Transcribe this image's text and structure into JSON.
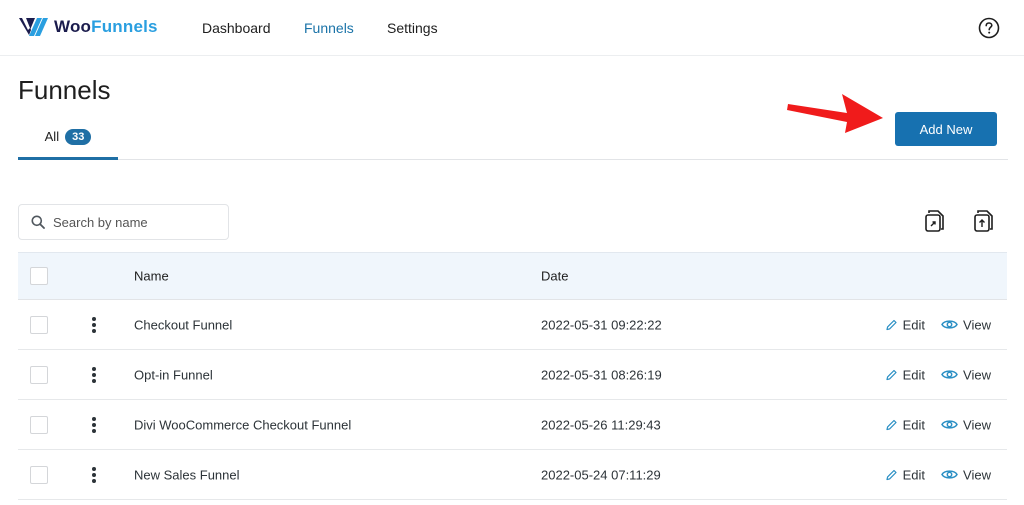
{
  "brand": {
    "part1": "Woo",
    "part2": "Funnels"
  },
  "nav": [
    {
      "label": "Dashboard",
      "active": false
    },
    {
      "label": "Funnels",
      "active": true
    },
    {
      "label": "Settings",
      "active": false
    }
  ],
  "help_icon": "help-circle-icon",
  "page": {
    "title": "Funnels"
  },
  "tabs": [
    {
      "label": "All",
      "count": "33"
    }
  ],
  "add_new_label": "Add New",
  "search": {
    "placeholder": "Search by name",
    "value": ""
  },
  "toolbar_icons": [
    "export-icon",
    "import-icon"
  ],
  "table": {
    "columns": {
      "name": "Name",
      "date": "Date"
    },
    "rows": [
      {
        "name": "Checkout Funnel",
        "date": "2022-05-31 09:22:22"
      },
      {
        "name": "Opt-in Funnel",
        "date": "2022-05-31 08:26:19"
      },
      {
        "name": "Divi WooCommerce Checkout Funnel",
        "date": "2022-05-26 11:29:43"
      },
      {
        "name": "New Sales Funnel",
        "date": "2022-05-24 07:11:29"
      }
    ],
    "actions": {
      "edit": "Edit",
      "view": "View"
    }
  },
  "colors": {
    "accent": "#1771b0",
    "nav_active": "#1a73a8",
    "logo_dark": "#1b1c4d",
    "logo_light": "#2a9fe0",
    "annotation_arrow": "#f01b1b"
  }
}
